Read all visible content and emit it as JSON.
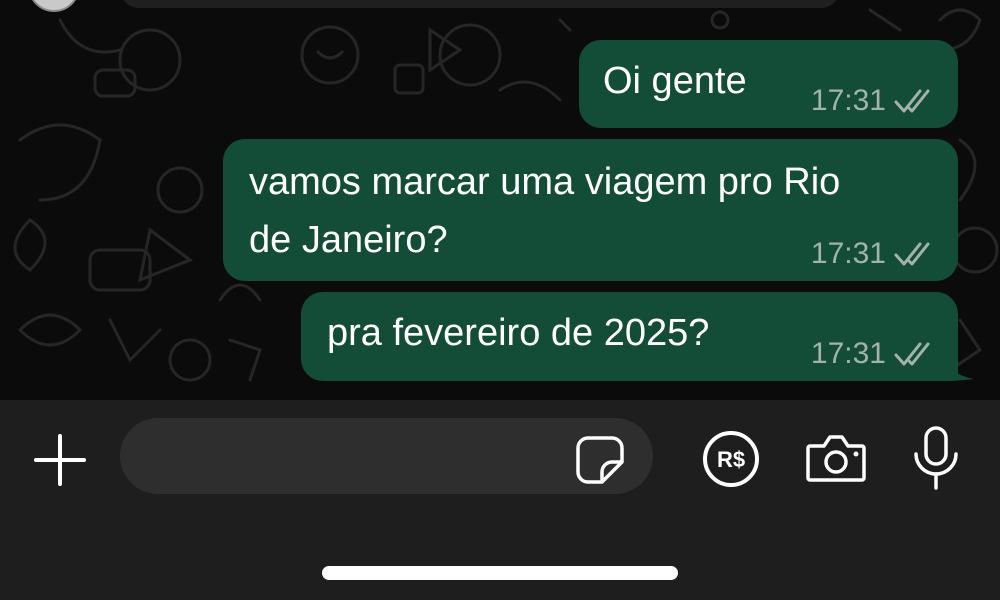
{
  "messages": [
    {
      "text": "Oi gente",
      "time": "17:31",
      "status": "read-double-check"
    },
    {
      "text": "vamos marcar uma viagem pro Rio\nde Janeiro?",
      "time": "17:31",
      "status": "read-double-check"
    },
    {
      "text": "pra fevereiro de 2025?",
      "time": "17:31",
      "status": "read-double-check"
    }
  ],
  "composer": {
    "input_value": "",
    "icons": [
      "plus-icon",
      "sticker-icon",
      "payment-rs-icon",
      "camera-icon",
      "microphone-icon"
    ],
    "payment_label": "R$"
  },
  "colors": {
    "outgoing_bubble": "#134d37",
    "timestamp": "#a3b3ab",
    "background": "#0b0b0b",
    "composer_bar": "#1e1e1e"
  }
}
